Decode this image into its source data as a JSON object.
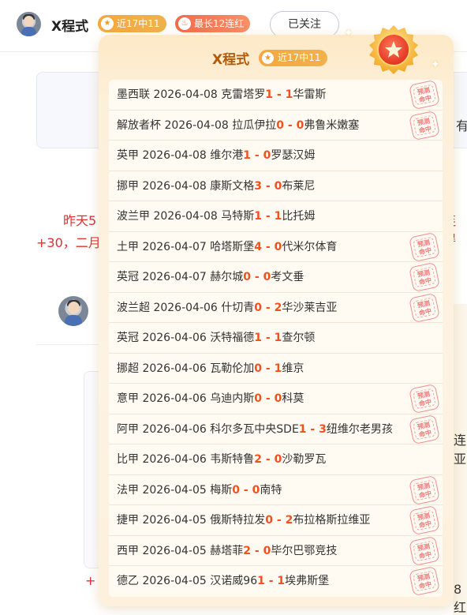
{
  "header": {
    "username": "X程式",
    "recent_badge": "近17中11",
    "recent_icon": "star-icon",
    "streak_badge": "最长12连红",
    "streak_icon": "fire-icon",
    "follow_label": "已关注"
  },
  "background": {
    "frag_right_1": "有",
    "frag_left_red_1": "昨天5",
    "frag_right_red_1": "连得",
    "frag_left_red_2": "+30，二月",
    "frag_right_2": "连亚",
    "frag_left_red_3": "+",
    "frag_right_3": "8红"
  },
  "popover": {
    "title": "X程式",
    "badge": "近17中11",
    "medal_icon": "star-medal-icon",
    "stamp_text": "预测\n命中",
    "colors": {
      "score": "#f2511e",
      "title": "#b25a07",
      "stamp": "#ee7b7b"
    },
    "rows": [
      {
        "league": "墨西联",
        "date": "2026-04-08",
        "home": "克雷塔罗",
        "hs": "1",
        "as": "1",
        "away": "华雷斯",
        "hit": true
      },
      {
        "league": "解放者杯",
        "date": "2026-04-08",
        "home": "拉瓜伊拉",
        "hs": "0",
        "as": "0",
        "away": "弗鲁米嫩塞",
        "hit": true
      },
      {
        "league": "英甲",
        "date": "2026-04-08",
        "home": "维尔港",
        "hs": "1",
        "as": "0",
        "away": "罗瑟汉姆",
        "hit": false
      },
      {
        "league": "挪甲",
        "date": "2026-04-08",
        "home": "康斯文格",
        "hs": "3",
        "as": "0",
        "away": "布莱尼",
        "hit": false
      },
      {
        "league": "波兰甲",
        "date": "2026-04-08",
        "home": "马特斯",
        "hs": "1",
        "as": "1",
        "away": "比托姆",
        "hit": false
      },
      {
        "league": "土甲",
        "date": "2026-04-07",
        "home": "哈塔斯堡",
        "hs": "4",
        "as": "0",
        "away": "代米尔体育",
        "hit": true
      },
      {
        "league": "英冠",
        "date": "2026-04-07",
        "home": "赫尔城",
        "hs": "0",
        "as": "0",
        "away": "考文垂",
        "hit": true
      },
      {
        "league": "波兰超",
        "date": "2026-04-06",
        "home": "什切青",
        "hs": "0",
        "as": "2",
        "away": "华沙莱吉亚",
        "hit": true
      },
      {
        "league": "英冠",
        "date": "2026-04-06",
        "home": "沃特福德",
        "hs": "1",
        "as": "1",
        "away": "查尔顿",
        "hit": false
      },
      {
        "league": "挪超",
        "date": "2026-04-06",
        "home": "瓦勒伦加",
        "hs": "0",
        "as": "1",
        "away": "维京",
        "hit": false
      },
      {
        "league": "意甲",
        "date": "2026-04-06",
        "home": "乌迪内斯",
        "hs": "0",
        "as": "0",
        "away": "科莫",
        "hit": true
      },
      {
        "league": "阿甲",
        "date": "2026-04-06",
        "home": "科尔多瓦中央SDE",
        "hs": "1",
        "as": "3",
        "away": "纽维尔老男孩",
        "hit": true
      },
      {
        "league": "比甲",
        "date": "2026-04-06",
        "home": "韦斯特鲁",
        "hs": "2",
        "as": "0",
        "away": "沙勒罗瓦",
        "hit": false
      },
      {
        "league": "法甲",
        "date": "2026-04-05",
        "home": "梅斯",
        "hs": "0",
        "as": "0",
        "away": "南特",
        "hit": true
      },
      {
        "league": "捷甲",
        "date": "2026-04-05",
        "home": "俄斯特拉发",
        "hs": "0",
        "as": "2",
        "away": "布拉格斯拉维亚",
        "hit": true
      },
      {
        "league": "西甲",
        "date": "2026-04-05",
        "home": "赫塔菲",
        "hs": "2",
        "as": "0",
        "away": "毕尔巴鄂竞技",
        "hit": true
      },
      {
        "league": "德乙",
        "date": "2026-04-05",
        "home": "汉诺威96",
        "hs": "1",
        "as": "1",
        "away": "埃弗斯堡",
        "hit": true
      }
    ]
  }
}
